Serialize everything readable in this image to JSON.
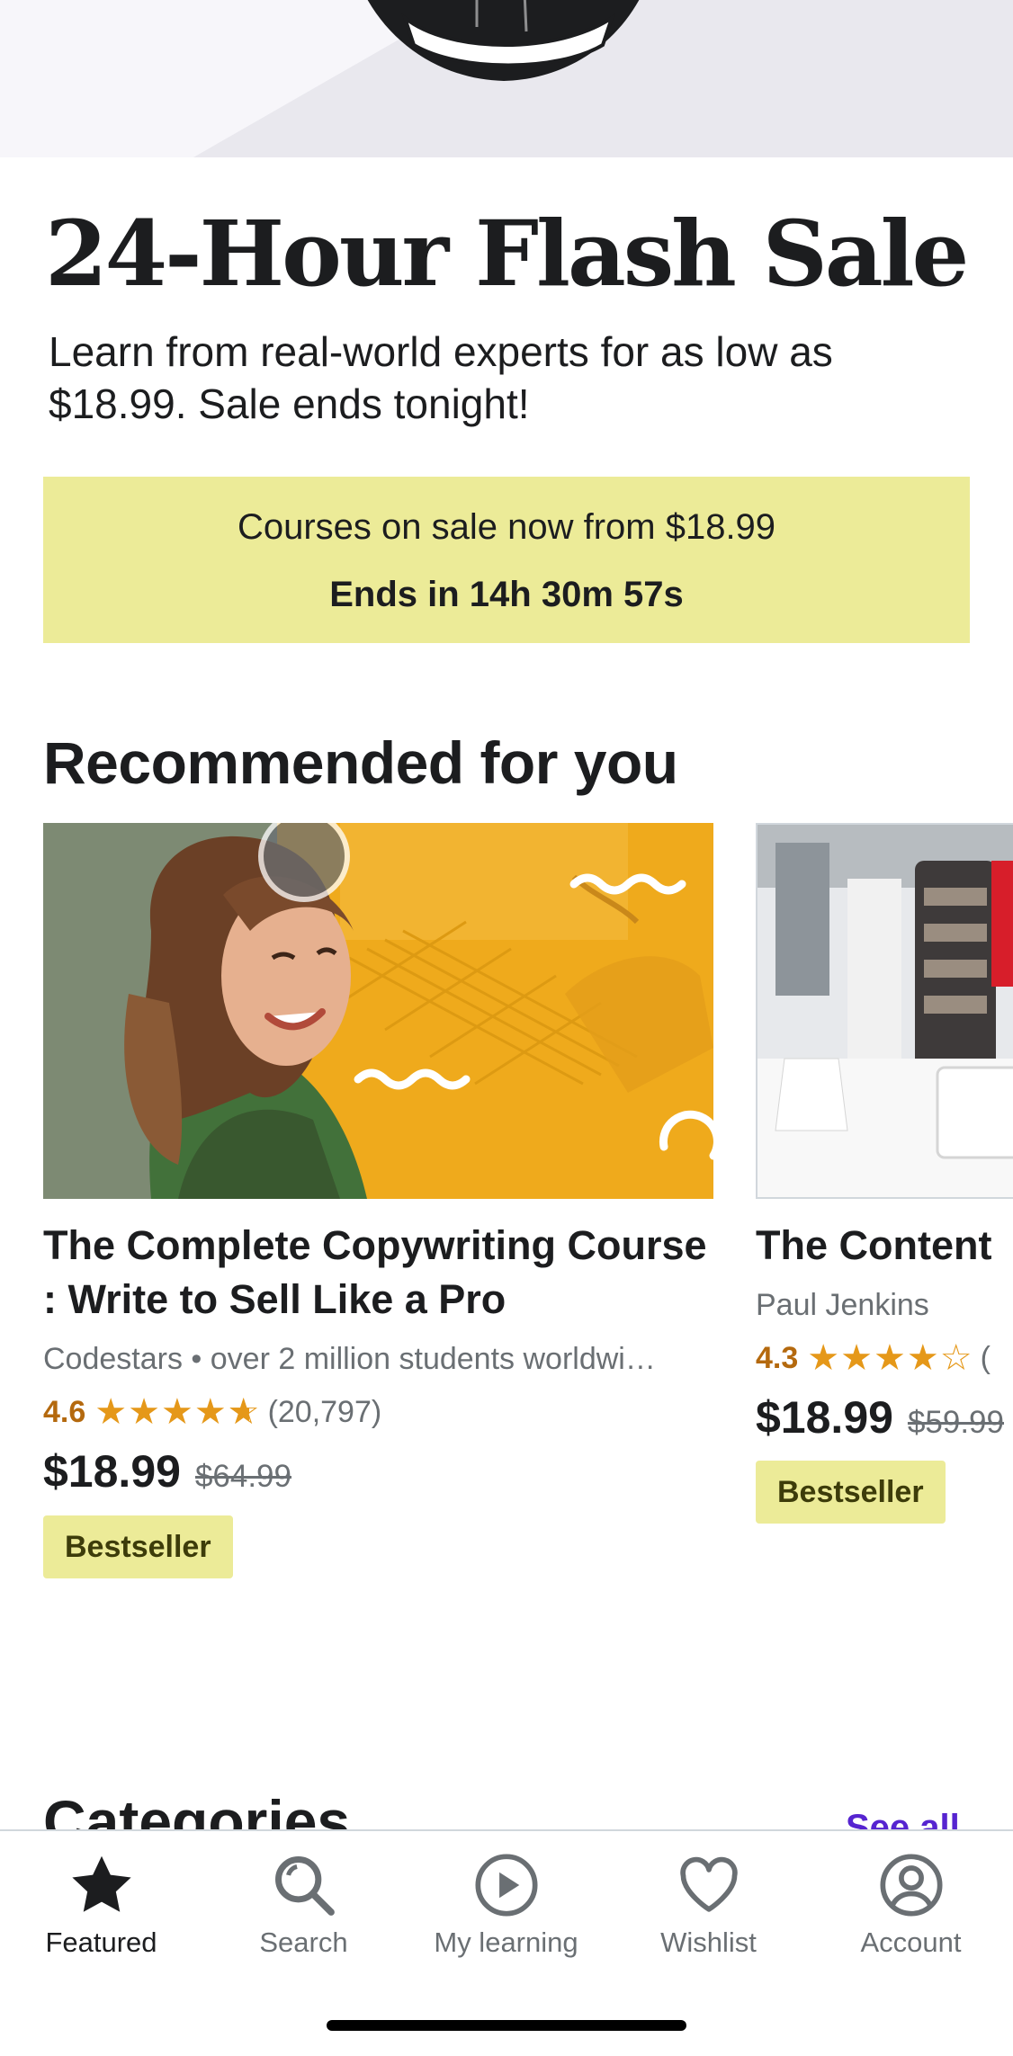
{
  "sale": {
    "title": "24-Hour Flash Sale",
    "subtitle": "Learn from real-world experts for as low as $18.99. Sale ends tonight!",
    "promo_line": "Courses on sale now from $18.99",
    "countdown": "Ends in 14h 30m 57s"
  },
  "recommended": {
    "title": "Recommended for you",
    "courses": [
      {
        "title": "The Complete Copywriting Course : Write to Sell Like a Pro",
        "instructor": "Codestars • over 2 million students worldwi…",
        "rating": "4.6",
        "rating_stars": 4.6,
        "rating_count": "(20,797)",
        "price": "$18.99",
        "original_price": "$64.99",
        "badge": "Bestseller"
      },
      {
        "title": "The Content",
        "instructor": "Paul Jenkins",
        "rating": "4.3",
        "rating_stars": 4.3,
        "rating_count": "(",
        "price": "$18.99",
        "original_price": "$59.99",
        "badge": "Bestseller"
      }
    ]
  },
  "categories": {
    "title": "Categories",
    "see_all": "See all"
  },
  "tabbar": {
    "items": [
      {
        "label": "Featured",
        "icon": "star-icon",
        "active": true
      },
      {
        "label": "Search",
        "icon": "search-icon",
        "active": false
      },
      {
        "label": "My learning",
        "icon": "play-circle-icon",
        "active": false
      },
      {
        "label": "Wishlist",
        "icon": "heart-icon",
        "active": false
      },
      {
        "label": "Account",
        "icon": "account-icon",
        "active": false
      }
    ]
  },
  "colors": {
    "promo_background": "#eceb98",
    "rating": "#b4690e",
    "star": "#e59819",
    "link": "#5624d0"
  }
}
